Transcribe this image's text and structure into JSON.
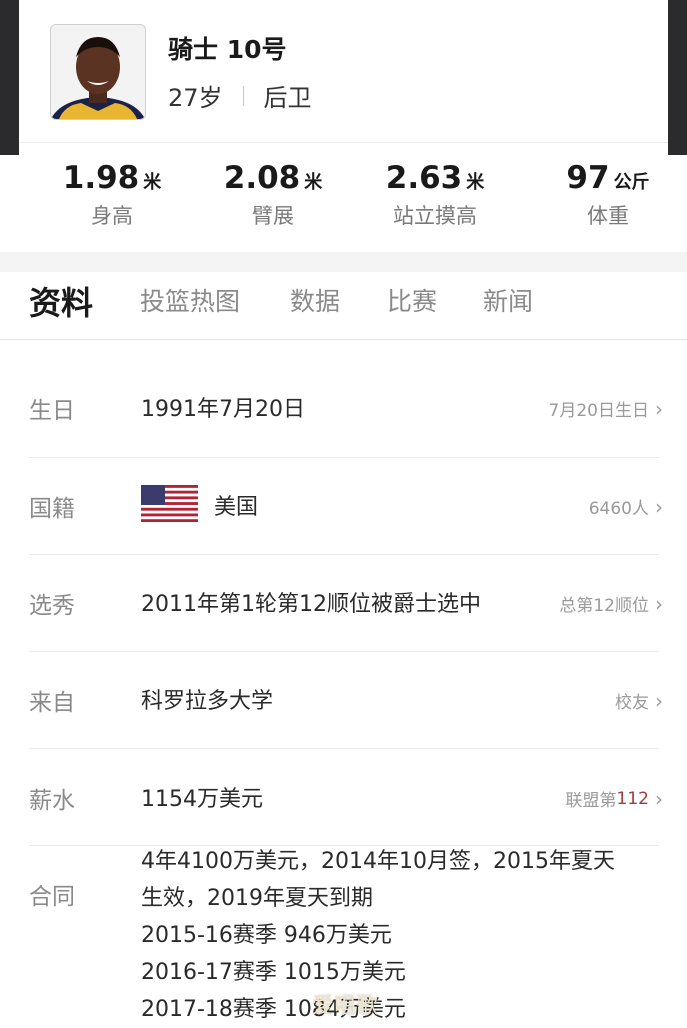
{
  "player": {
    "name": "骑士 10号",
    "age": "27岁",
    "position": "后卫"
  },
  "stats": [
    {
      "value": "1.98",
      "unit": "米",
      "label": "身高"
    },
    {
      "value": "2.08",
      "unit": "米",
      "label": "臂展"
    },
    {
      "value": "2.63",
      "unit": "米",
      "label": "站立摸高"
    },
    {
      "value": "97",
      "unit": "公斤",
      "label": "体重"
    }
  ],
  "tabs": [
    "资料",
    "投篮热图",
    "数据",
    "比赛",
    "新闻"
  ],
  "profile": {
    "birthday": {
      "label": "生日",
      "value": "1991年7月20日",
      "link": "7月20日生日"
    },
    "nationality": {
      "label": "国籍",
      "value": "美国",
      "link": "6460人"
    },
    "draft": {
      "label": "选秀",
      "value": "2011年第1轮第12顺位被爵士选中",
      "link": "总第12顺位"
    },
    "college": {
      "label": "来自",
      "value": "科罗拉多大学",
      "link": "校友"
    },
    "salary": {
      "label": "薪水",
      "value": "1154万美元",
      "link_prefix": "联盟第",
      "link_rank": "112"
    },
    "contract": {
      "label": "合同",
      "lines": [
        "4年4100万美元，2014年10月签，2015年夏天",
        "生效，2019年夏天到期",
        "2015-16赛季 946万美元",
        "2016-17赛季 1015万美元",
        "2017-18赛季 1084万美元"
      ]
    }
  },
  "watermark": "爱唱歌",
  "colors": {
    "header_bg": "#2b2b2d",
    "accent_rank": "#a23a3a"
  },
  "icons": {
    "chevron": "chevron-right-icon",
    "flag": "us-flag-icon"
  }
}
